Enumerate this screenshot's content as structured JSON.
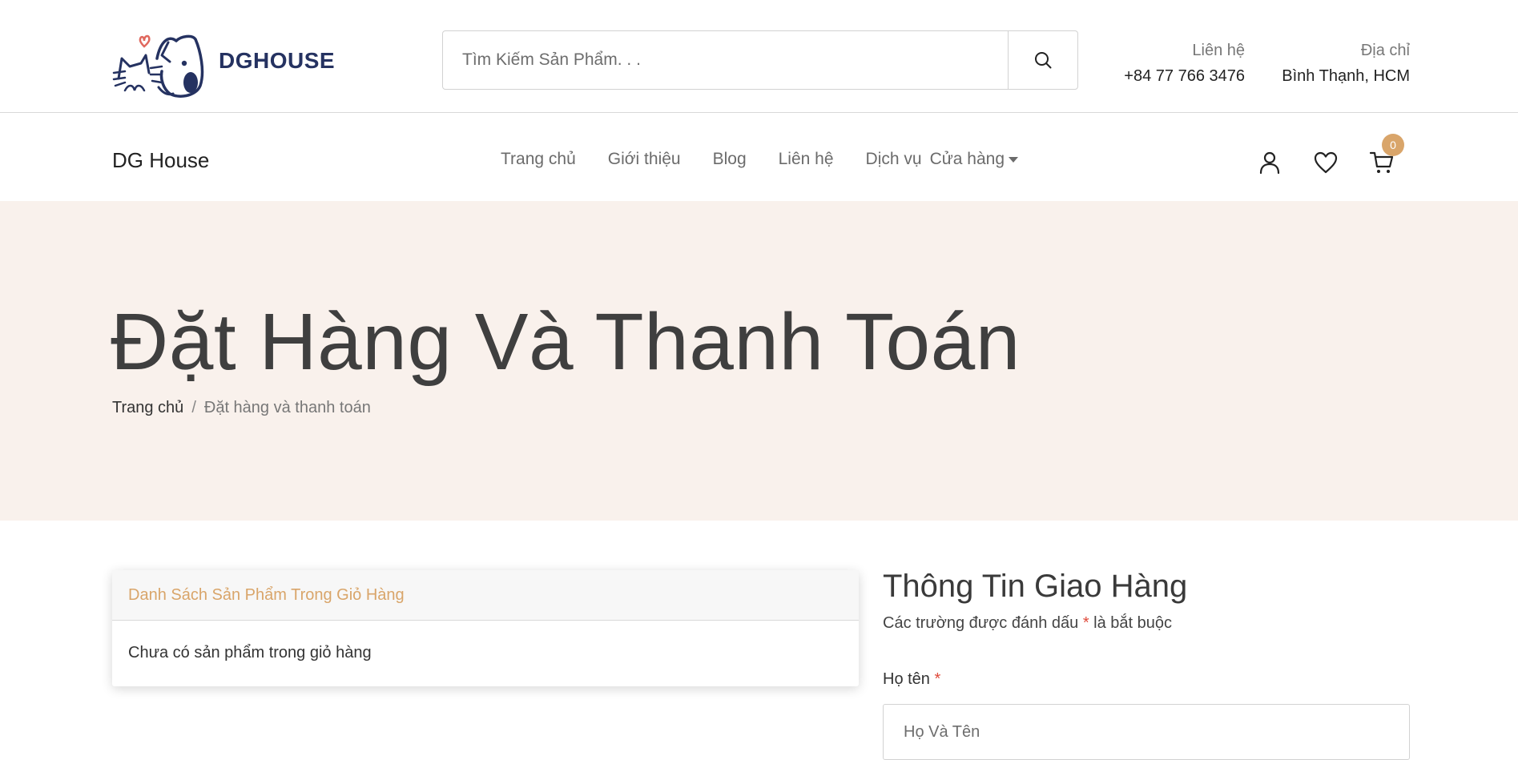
{
  "header": {
    "logo_text": "DGHOUSE",
    "search": {
      "placeholder": "Tìm Kiếm Sản Phẩm. . ."
    },
    "contact": {
      "label": "Liên hệ",
      "value": "+84 77 766 3476"
    },
    "address": {
      "label": "Địa chỉ",
      "value": "Bình Thạnh, HCM"
    }
  },
  "nav": {
    "brand": "DG House",
    "items": [
      {
        "label": "Trang chủ"
      },
      {
        "label": "Giới thiệu"
      },
      {
        "label": "Blog"
      },
      {
        "label": "Liên hệ"
      },
      {
        "label": "Dịch vụ"
      },
      {
        "label": "Cửa hàng"
      }
    ],
    "cart_count": "0"
  },
  "hero": {
    "title": "Đặt Hàng Và Thanh Toán",
    "breadcrumb": {
      "home": "Trang chủ",
      "separator": "/",
      "current": "Đặt hàng và thanh toán"
    }
  },
  "cart": {
    "header": "Danh Sách Sản Phẩm Trong Giỏ Hàng",
    "empty_message": "Chưa có sản phẩm trong giỏ hàng"
  },
  "shipping": {
    "title": "Thông Tin Giao Hàng",
    "note_before": "Các trường được đánh dấu",
    "required_mark": "*",
    "note_after": "là bắt buộc",
    "fullname": {
      "label": "Họ tên",
      "placeholder": "Họ Và Tên"
    }
  },
  "colors": {
    "accent": "#d9a56a",
    "hero_bg": "#f9f1ec",
    "logo_navy": "#253261",
    "logo_heart": "#e0685e",
    "required": "#e04a3b"
  }
}
